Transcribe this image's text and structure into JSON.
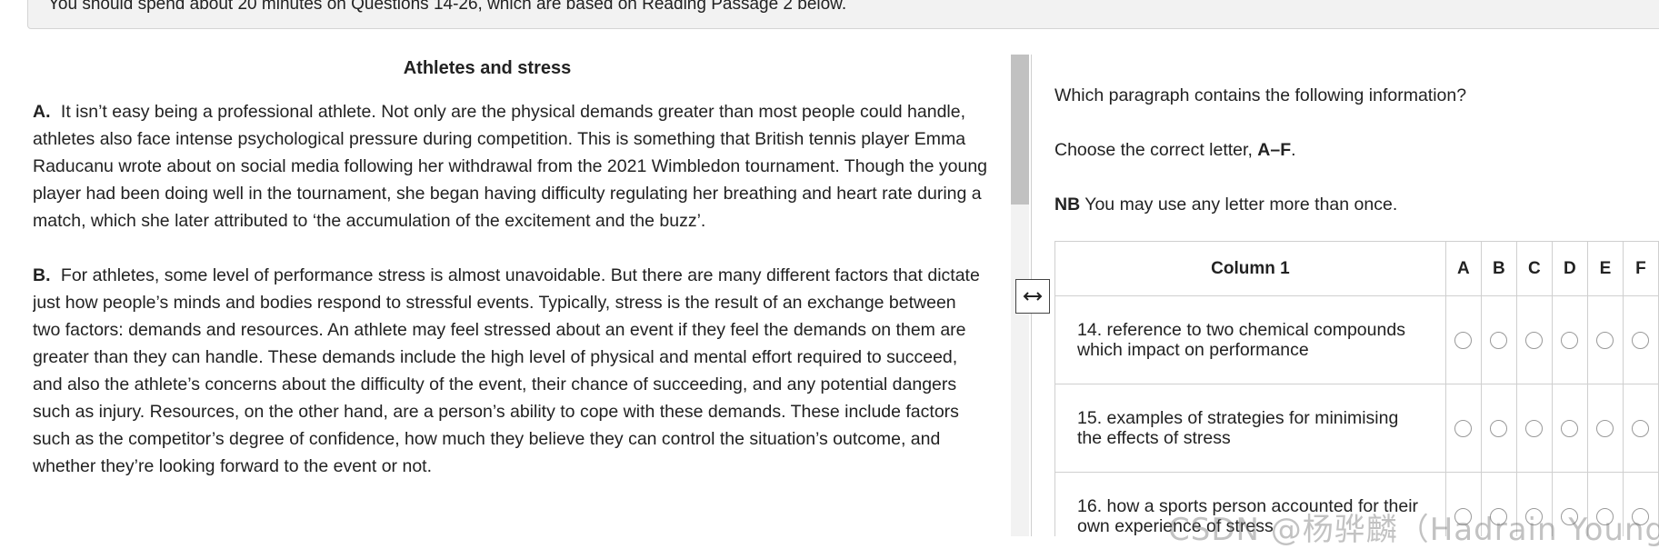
{
  "instruction": "You should spend about 20 minutes on Questions 14-26, which are based on Reading Passage 2 below.",
  "passage": {
    "title": "Athletes and stress",
    "paragraphs": [
      {
        "letter": "A.",
        "text": "It isn’t easy being a professional athlete. Not only are the physical demands greater than most people could handle, athletes also face intense psychological pressure during competition. This is something that British tennis player Emma Raducanu wrote about on social media following her withdrawal from the 2021 Wimbledon tournament. Though the young player had been doing well in the tournament, she began having difficulty regulating her breathing and heart rate during a match, which she later attributed to ‘the accumulation of the excitement and the buzz’."
      },
      {
        "letter": "B.",
        "text": "For athletes, some level of performance stress is almost unavoidable. But there are many different factors that dictate just how people’s minds and bodies respond to stressful events. Typically, stress is the result of an exchange between two factors: demands and resources. An athlete may feel stressed about an event if they feel the demands on them are greater than they can handle. These demands include the high level of physical and mental effort required to succeed, and also the athlete’s concerns about the difficulty of the event, their chance of succeeding, and any potential dangers such as injury. Resources, on the other hand, are a person’s ability to cope with these demands. These include factors such as the competitor’s degree of confidence, how much they believe they can control the situation’s outcome, and whether they’re looking forward to the event or not."
      }
    ]
  },
  "questions_panel": {
    "intro": "Which paragraph contains the following information?",
    "choose_prefix": "Choose the correct letter,",
    "choose_letters": "A–F",
    "choose_suffix": ".",
    "nb_label": "NB",
    "nb_text": "You may use any letter more than once.",
    "table": {
      "column1_header": "Column 1",
      "letters": [
        "A",
        "B",
        "C",
        "D",
        "E",
        "F"
      ],
      "rows": [
        "14. reference to two chemical compounds which impact on performance",
        "15. examples of strategies for minimising the effects of stress",
        "16. how a sports person accounted for their own experience of stress"
      ]
    }
  },
  "icons": {
    "resize": "horizontal-resize-icon"
  },
  "watermark": "CSDN @杨骅麟（Hadrain Young）"
}
